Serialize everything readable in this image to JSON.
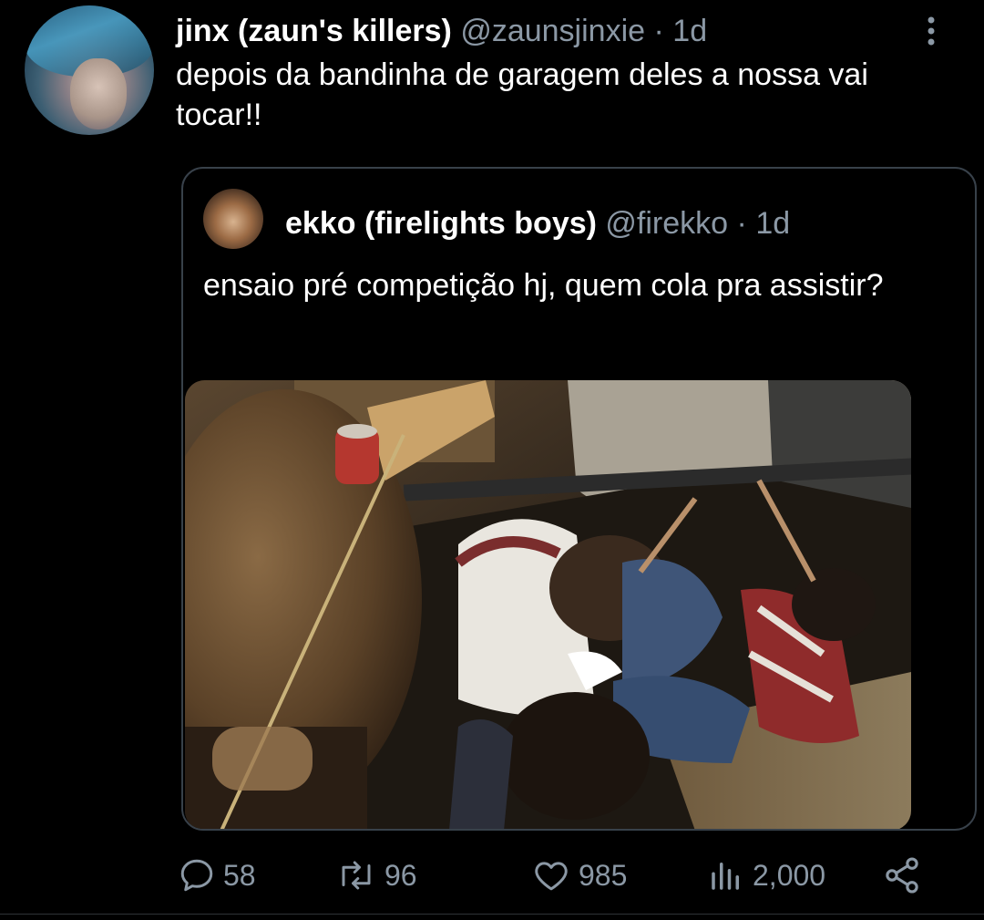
{
  "tweet": {
    "display_name": "jinx (zaun's killers)",
    "handle": "@zaunsjinxie",
    "separator": "·",
    "time": "1d",
    "text": "depois da bandinha de garagem deles a nossa vai tocar!!",
    "avatar_icon": "user-avatar"
  },
  "quoted_tweet": {
    "display_name": "ekko (firelights boys)",
    "handle": "@firekko",
    "separator": "·",
    "time": "1d",
    "text": "ensaio pré competição hj, quem cola pra assistir?",
    "avatar_icon": "user-avatar",
    "media_icon": "photo-band-rehearsal"
  },
  "actions": {
    "replies": "58",
    "retweets": "96",
    "likes": "985",
    "views": "2,000",
    "icons": [
      "reply-icon",
      "retweet-icon",
      "heart-icon",
      "views-icon",
      "share-icon"
    ]
  },
  "colors": {
    "background": "#000000",
    "text_primary": "#ffffff",
    "text_secondary": "#8b98a5",
    "border": "#38414a"
  }
}
